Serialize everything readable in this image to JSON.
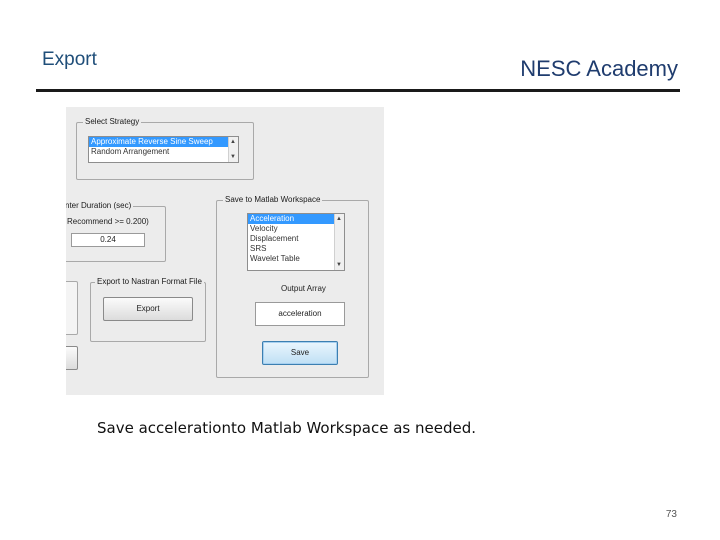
{
  "slide": {
    "title_left": "Export",
    "title_right": "NESC Academy",
    "caption": "Save accelerationto Matlab Workspace as needed.",
    "page_number": "73"
  },
  "app": {
    "select_strategy": {
      "label": "Select Strategy",
      "items": [
        "Approximate Reverse Sine Sweep",
        "Random Arrangement"
      ],
      "selected_index": 0
    },
    "duration": {
      "label": "nter Duration (sec)",
      "recommend": "Recommend >= 0.200)",
      "value": "0.24"
    },
    "save_workspace": {
      "label": "Save to Matlab Workspace",
      "items": [
        "Acceleration",
        "Velocity",
        "Displacement",
        "SRS",
        "Wavelet Table"
      ],
      "selected_index": 0,
      "output_label": "Output Array",
      "output_value": "acceleration",
      "save_button": "Save"
    },
    "export_nastran": {
      "label": "Export to Nastran Format File",
      "button": "Export"
    }
  }
}
